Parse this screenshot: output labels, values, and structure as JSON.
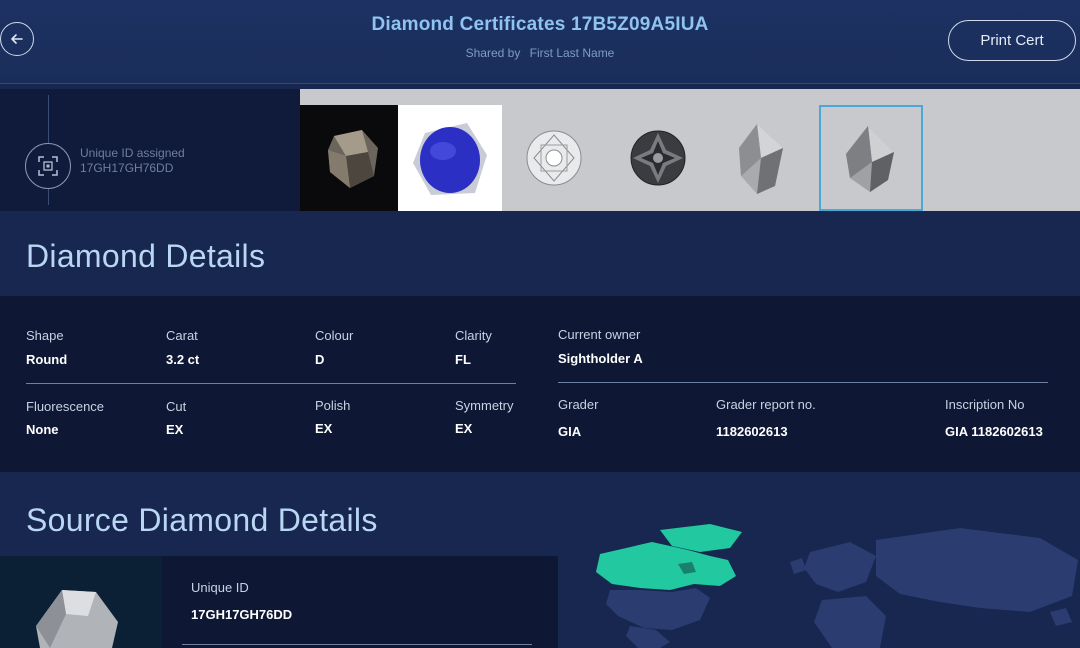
{
  "header": {
    "title": "Diamond Certificates 17B5Z09A5IUA",
    "shared_label": "Shared by",
    "shared_name": "First Last Name",
    "print_label": "Print Cert",
    "back_icon": "arrow-left-icon"
  },
  "gallery": {
    "uid_label": "Unique ID assigned",
    "uid_value": "17GH17GH76DD",
    "uid_icon": "scan-frame-icon",
    "selected_index": 5,
    "thumbnails": [
      "rough-diamond",
      "blue-scan",
      "round-brilliant-top",
      "round-brilliant-dark",
      "rough-crystal",
      "rough-crystal-selected"
    ]
  },
  "diamond_details": {
    "title": "Diamond Details",
    "row1": [
      {
        "label": "Shape",
        "value": "Round"
      },
      {
        "label": "Carat",
        "value": "3.2 ct"
      },
      {
        "label": "Colour",
        "value": "D"
      },
      {
        "label": "Clarity",
        "value": "FL"
      }
    ],
    "row2": [
      {
        "label": "Fluorescence",
        "value": "None"
      },
      {
        "label": "Cut",
        "value": "EX"
      },
      {
        "label": "Polish",
        "value": "EX"
      },
      {
        "label": "Symmetry",
        "value": "EX"
      }
    ],
    "owner": {
      "label": "Current owner",
      "value": "Sightholder A"
    },
    "grader": [
      {
        "label": "Grader",
        "value": "GIA"
      },
      {
        "label": "Grader report no.",
        "value": "1182602613"
      },
      {
        "label": "Inscription No",
        "value": "GIA 1182602613"
      }
    ]
  },
  "source_details": {
    "title": "Source Diamond Details",
    "uid_label": "Unique ID",
    "uid_value": "17GH17GH76DD"
  },
  "colors": {
    "background": "#17274f",
    "panel": "#0e1733",
    "title_accent": "#8fc3f0",
    "map_highlight": "#22c9a0",
    "selected_border": "#4aa7d8"
  }
}
